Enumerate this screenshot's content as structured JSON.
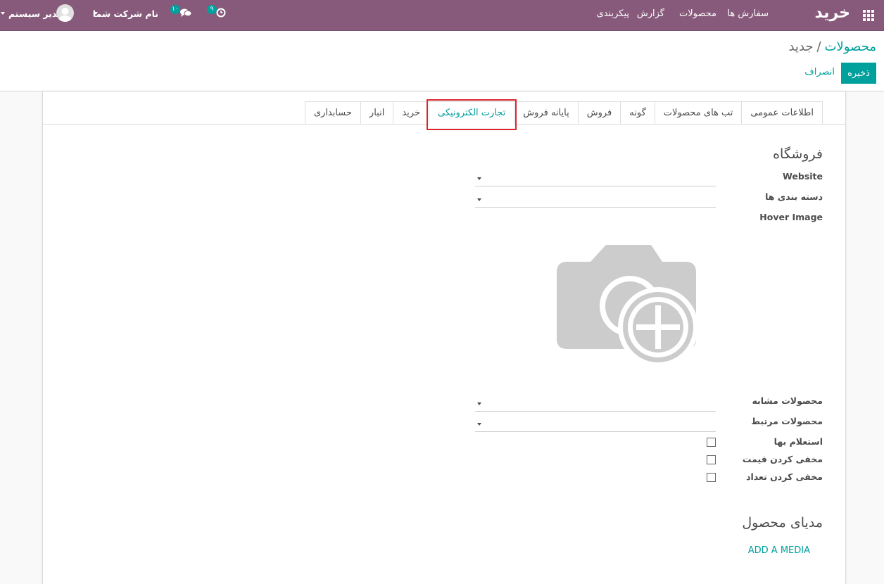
{
  "topbar": {
    "brand": "خرید",
    "menu": [
      "سفارش ها",
      "محصولات",
      "گزارش",
      "پیکربندی"
    ],
    "activities_count": "۹",
    "messages_count": "۱۰",
    "company": "نام شرکت شما",
    "user": "مدیر سیستم",
    "icons": [
      "apps-icon",
      "clock-icon",
      "chat-icon",
      "caret-down-icon",
      "avatar-icon"
    ]
  },
  "breadcrumb": {
    "parent": "محصولات",
    "separator": "/",
    "current": "جدید"
  },
  "buttons": {
    "save": "ذخیره",
    "discard": "انصراف"
  },
  "tabs": [
    "اطلاعات عمومی",
    "تب های محصولات",
    "گونه",
    "فروش",
    "پایانه فروش",
    "تجارت الکترونیکی",
    "خرید",
    "انبار",
    "حسابداری"
  ],
  "active_tab": "تجارت الکترونیکی",
  "shop_section": {
    "title": "فروشگاه",
    "website_label": "Website",
    "categories_label": "دسته بندی ها",
    "hover_image_label": "Hover Image",
    "similar_products_label": "محصولات مشابه",
    "related_products_label": "محصولات مرتبط",
    "request_price_label": "استعلام بها",
    "hide_price_label": "مخفی کردن قیمت",
    "hide_quantity_label": "مخفی کردن تعداد"
  },
  "media_section": {
    "title": "مدیای محصول",
    "add_media": "ADD A MEDIA"
  },
  "colors": {
    "topbar": "#875a7b",
    "accent": "#00a09d",
    "highlight": "#d9262e"
  }
}
